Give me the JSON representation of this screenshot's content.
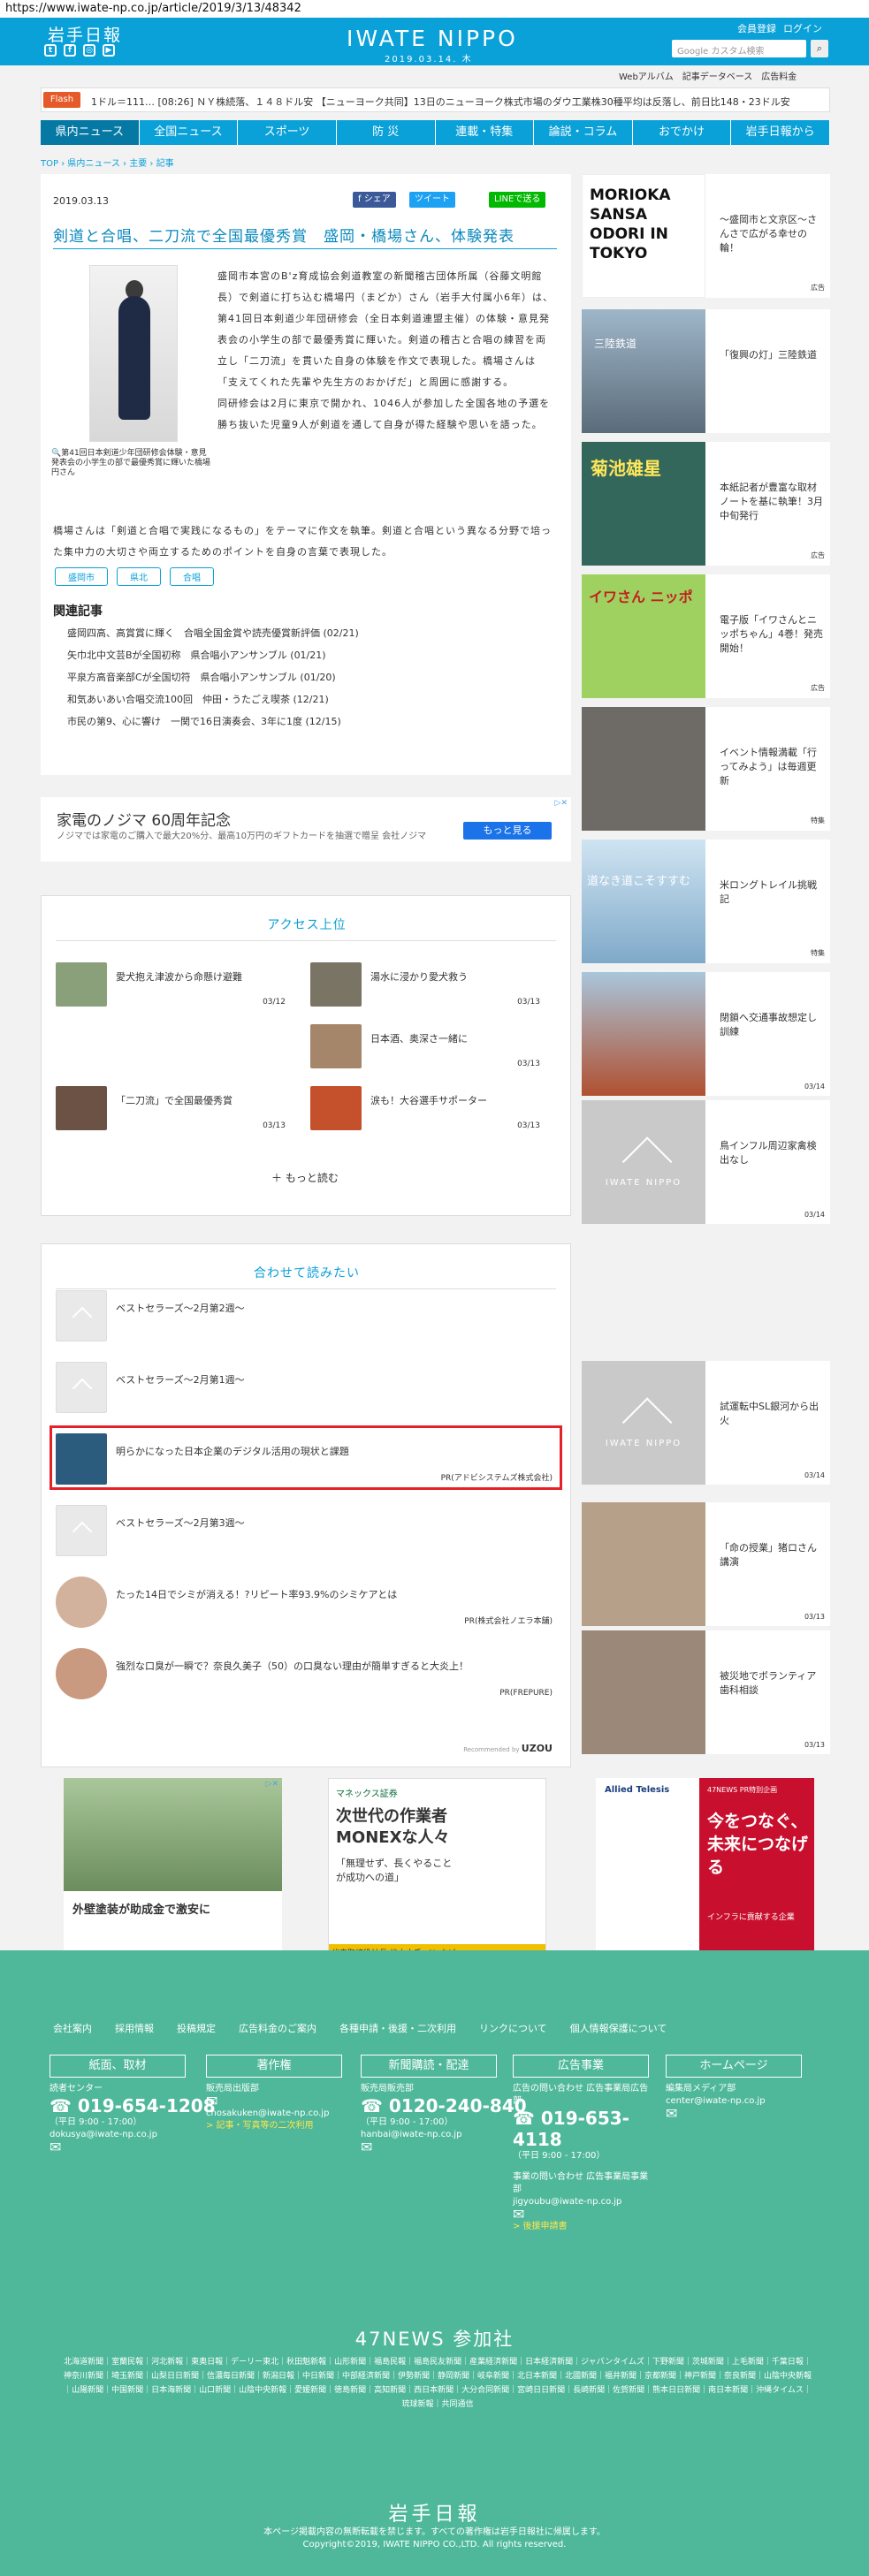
{
  "url": "https://www.iwate-np.co.jp/article/2019/3/13/48342",
  "header": {
    "logo": "岩手日報",
    "brand": "IWATE NIPPO",
    "date": "2019.03.14. 木",
    "register": "会員登録",
    "login": "ログイン",
    "search_placeholder": "Google カスタム検索",
    "search_icon": "magnifier-icon"
  },
  "subnav": [
    "Webアルバム",
    "記事データベース",
    "広告料金"
  ],
  "flash": {
    "label": "Flash",
    "text": "1ドル＝111… [08:26] ＮＹ株続落、１４８ドル安 【ニューヨーク共同】13日のニューヨーク株式市場のダウ工業株30種平均は反落し、前日比148・23ドル安"
  },
  "nav": [
    "県内ニュース",
    "全国ニュース",
    "スポーツ",
    "防 災",
    "連載・特集",
    "論説・コラム",
    "おでかけ",
    "岩手日報から"
  ],
  "breadcrumb": "TOP › 県内ニュース › 主要 › 記事",
  "article": {
    "date": "2019.03.13",
    "share": "f シェア",
    "tweet": "ツイート",
    "line": "LINEで送る",
    "title": "剣道と合唱、二刀流で全国最優秀賞　盛岡・橋場さん、体験発表",
    "caption": "第41回日本剣道少年団研修会体験・意見発表会の小学生の部で最優秀賞に輝いた橋場円さん",
    "p1": "盛岡市本宮のB'z育成協会剣道教室の新聞稽古団体所属（谷藤文明館長）で剣道に打ち込む橋場円（まどか）さん（岩手大付属小6年）は、第41回日本剣道少年団研修会（全日本剣道連盟主催）の体験・意見発表会の小学生の部で最優秀賞に輝いた。剣道の稽古と合唱の練習を両立し「二刀流」を貫いた自身の体験を作文で表現した。橋場さんは「支えてくれた先輩や先生方のおかげだ」と周囲に感謝する。",
    "p2": "同研修会は2月に東京で開かれ、1046人が参加した全国各地の予選を勝ち抜いた児童9人が剣道を通して自身が得た経験や思いを語った。",
    "p3": "橋場さんは「剣道と合唱で実践になるもの」をテーマに作文を執筆。剣道と合唱という異なる分野で培った集中力の大切さや両立するためのポイントを自身の言葉で表現した。",
    "tags": [
      "盛岡市",
      "県北",
      "合唱"
    ],
    "related_heading": "関連記事",
    "related": [
      "盛岡四高、高賞賞に輝く　合唱全国金賞や読売優賞新評価 (02/21)",
      "矢巾北中文芸Bが全国初称　県合唱小アンサンブル (01/21)",
      "平泉方高音楽部Cが全国切符　県合唱小アンサンブル (01/20)",
      "和気あいあい合唱交流100回　仲田・うたごえ喫茶 (12/21)",
      "市民の第9、心に響け　一関で16日演奏会、3年に1度 (12/15)"
    ]
  },
  "ad_banner": {
    "title": "家電のノジマ 60周年記念",
    "text": "ノジマでは家電のご購入で最大20%分、最高10万円のギフトカードを抽選で贈呈 会社ノジマ",
    "button": "もっと見る",
    "mark": "▷✕"
  },
  "ranking": {
    "heading": "アクセス上位",
    "items": [
      {
        "title": "愛犬抱え津波から命懸け避難",
        "date": "03/12"
      },
      {
        "title": "湯水に浸かり愛犬救う",
        "date": "03/13"
      },
      {
        "title": "日本酒、奥深さ一緒に",
        "date": "03/13"
      },
      {
        "title": "「二刀流」で全国最優秀賞",
        "date": "03/13"
      },
      {
        "title": "涙も！大谷選手サポーター",
        "date": "03/13"
      }
    ],
    "more": "もっと読む"
  },
  "recommend": {
    "heading": "合わせて読みたい",
    "items": [
      {
        "title": "ベストセラーズ～2月第2週～",
        "pr": ""
      },
      {
        "title": "ベストセラーズ～2月第1週～",
        "pr": ""
      },
      {
        "title": "明らかになった日本企業のデジタル活用の現状と課題",
        "pr": "PR(アドビシステムズ株式会社)"
      },
      {
        "title": "ベストセラーズ～2月第3週～",
        "pr": ""
      },
      {
        "title": "たった14日でシミが消える！?リピート率93.9%のシミケアとは",
        "pr": "PR(株式会社ノエラ本舗)"
      },
      {
        "title": "強烈な口臭が一瞬で？奈良久美子（50）の口臭ない理由が簡単すぎると大炎上！",
        "pr": "PR(FREPURE)"
      }
    ],
    "by": "Recommended by",
    "brand": "UZOU"
  },
  "sidebar": [
    {
      "title": "～盛岡市と文京区～さんさで広がる幸せの輪！",
      "date": "広告",
      "img": "MORIOKA SANSA ODORI IN TOKYO"
    },
    {
      "title": "「復興の灯」三陸鉄道",
      "date": "",
      "img": "三陸鉄道"
    },
    {
      "title": "本紙記者が豊富な取材ノートを基に執筆！3月中旬発行",
      "date": "広告",
      "img": "菊池雄星"
    },
    {
      "title": "電子版「イワさんとニッポちゃん」4巻！発売開始！",
      "date": "広告",
      "img": "イワさん ニッポ"
    },
    {
      "title": "イベント情報満載「行ってみよう」は毎週更新",
      "date": "特集",
      "img": ""
    },
    {
      "title": "米ロングトレイル挑戦記",
      "date": "特集",
      "img": "道なき道こそすすむ"
    },
    {
      "title": "閉鎖へ交通事故想定し訓練",
      "date": "03/14",
      "img": ""
    },
    {
      "title": "鳥インフル周辺家禽検出なし",
      "date": "03/14",
      "img": "IWATE NIPPO"
    },
    {
      "title": "試運転中SL銀河から出火",
      "date": "03/14",
      "img": "IWATE NIPPO"
    },
    {
      "title": "「命の授業」猪ロさん講演",
      "date": "03/13",
      "img": ""
    },
    {
      "title": "被災地でボランティア歯科相談",
      "date": "03/13",
      "img": ""
    }
  ],
  "bottom_ads": [
    {
      "title": "外壁塗装が助成金で激安に",
      "text": "",
      "tag": "▷✕"
    },
    {
      "title": "次世代の作業者 MONEXな人々",
      "text": "「無理せず、長くやることが成功への道」",
      "sub": "代表取締役社長 松本大氏 インタビュー",
      "brand": "マネックス証券"
    },
    {
      "title": "今をつなぐ、未来につなげる",
      "text": "インフラに貢献する企業",
      "brand": "Allied Telesis",
      "tag": "47NEWS PR特別企画"
    }
  ],
  "footer": {
    "links": [
      "会社案内",
      "採用情報",
      "投稿規定",
      "広告料金のご案内",
      "各種申請・後援・二次利用",
      "リンクについて",
      "個人情報保護について"
    ],
    "cols": [
      {
        "btn": "紙面、取材",
        "l1": "読者センター",
        "tel": "019-654-1208",
        "hours": "（平日 9:00 - 17:00）",
        "mail": "dokusya@iwate-np.co.jp"
      },
      {
        "btn": "著作権",
        "l1": "販売局出版部",
        "tel": "",
        "hours": "",
        "mail": "chosakuken@iwate-np.co.jp",
        "extra": "> 記事・写真等の二次利用"
      },
      {
        "btn": "新聞購読・配達",
        "l1": "販売局販売部",
        "tel": "0120-240-840",
        "hours": "（平日 9:00 - 17:00）",
        "mail": "hanbai@iwate-np.co.jp"
      },
      {
        "btn": "広告事業",
        "l1": "広告の問い合わせ 広告事業局広告部",
        "tel": "019-653-4118",
        "hours": "（平日 9:00 - 17:00）",
        "mail": "",
        "l2": "事業の問い合わせ 広告事業局事業部",
        "mail2": "jigyoubu@iwate-np.co.jp",
        "extra": "> 後援申請書"
      },
      {
        "btn": "ホームページ",
        "l1": "編集局メディア部",
        "tel": "",
        "hours": "",
        "mail": "center@iwate-np.co.jp"
      }
    ],
    "news_heading": "47NEWS 参加社",
    "papers": "北海道新聞｜室蘭民報｜河北新報｜東奥日報｜デーリー東北｜秋田魁新報｜山形新聞｜福島民報｜福島民友新聞｜産業経済新聞｜日本経済新聞｜ジャパンタイムズ｜下野新聞｜茨城新聞｜上毛新聞｜千葉日報｜神奈川新聞｜埼玉新聞｜山梨日日新聞｜信濃毎日新聞｜新潟日報｜中日新聞｜中部経済新聞｜伊勢新聞｜静岡新聞｜岐阜新聞｜北日本新聞｜北國新聞｜福井新聞｜京都新聞｜神戸新聞｜奈良新聞｜山陰中央新報｜山陽新聞｜中国新聞｜日本海新聞｜山口新聞｜山陰中央新報｜愛媛新聞｜徳島新聞｜高知新聞｜西日本新聞｜大分合同新聞｜宮崎日日新聞｜長崎新聞｜佐賀新聞｜熊本日日新聞｜南日本新聞｜沖縄タイムス｜琉球新報｜共同通信",
    "logo": "岩手日報",
    "note": "本ページ掲載内容の無断転載を禁じます。すべての著作権は岩手日報社に帰属します。",
    "copyright": "Copyright©2019, IWATE NIPPO CO.,LTD. All rights reserved."
  }
}
